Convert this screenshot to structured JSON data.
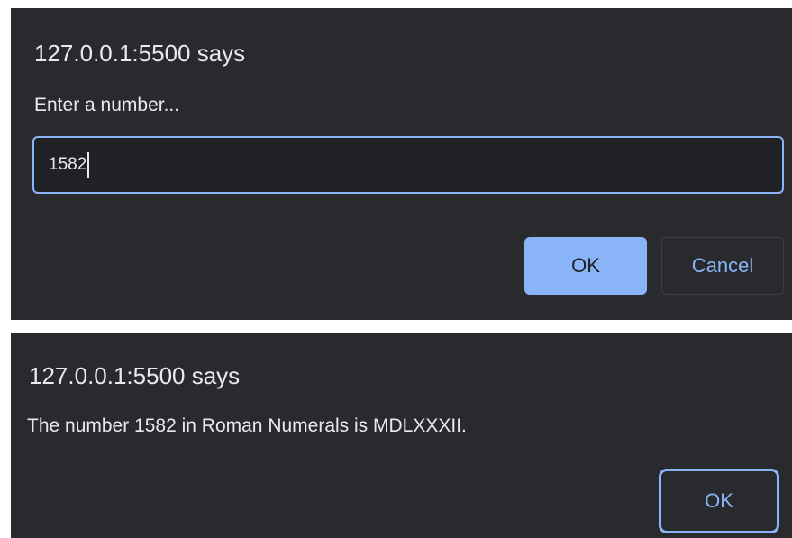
{
  "prompt_dialog": {
    "title": "127.0.0.1:5500 says",
    "message": "Enter a number...",
    "input_value": "1582",
    "ok_label": "OK",
    "cancel_label": "Cancel"
  },
  "alert_dialog": {
    "title": "127.0.0.1:5500 says",
    "message": "The number 1582 in Roman Numerals is MDLXXXII.",
    "ok_label": "OK"
  },
  "colors": {
    "dialog_background": "#292a2d",
    "input_background": "#202124",
    "accent": "#8ab4f8",
    "text": "#e8eaed"
  }
}
